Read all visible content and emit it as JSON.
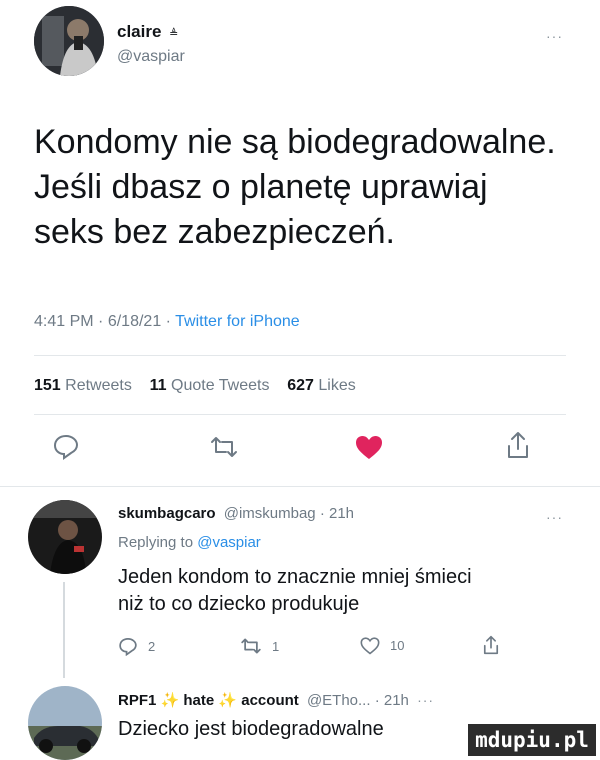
{
  "main_tweet": {
    "display_name": "claire",
    "badge": "≜",
    "handle": "@vaspiar",
    "more": "···",
    "text_line1": "Kondomy nie są biodegradowalne.",
    "text_line2": "Jeśli dbasz o planetę uprawiaj",
    "text_line3": "seks bez zabezpieczeń.",
    "time": "4:41 PM",
    "date": "6/18/21",
    "source": "Twitter for iPhone",
    "sep": "·",
    "stats": {
      "retweets_count": "151",
      "retweets_label": "Retweets",
      "quotes_count": "11",
      "quotes_label": "Quote Tweets",
      "likes_count": "627",
      "likes_label": "Likes"
    },
    "icons": [
      "reply-icon",
      "retweet-icon",
      "like-icon",
      "share-icon"
    ],
    "colors": {
      "like": "#e0245e",
      "link": "#2a8ee6",
      "muted": "#6e7a85"
    }
  },
  "reply1": {
    "name": "skumbagcaro",
    "handle": "@imskumbag",
    "time": "21h",
    "sep": "·",
    "more": "···",
    "replying_prefix": "Replying to",
    "replying_to": "@vaspiar",
    "text_line1": "Jeden kondom to znacznie mniej śmieci",
    "text_line2": "niż to co dziecko produkuje",
    "reply_count": "2",
    "retweet_count": "1",
    "like_count": "10"
  },
  "reply2": {
    "name": "RPF1",
    "name_emoji1": "✨",
    "name_mid": "hate",
    "name_emoji2": "✨",
    "name_end": "account",
    "handle": "@ETho...",
    "time": "21h",
    "sep": "·",
    "more": "···",
    "text_line1": "Dziecko jest biodegradowalne"
  },
  "watermark": "mdupiu.pl"
}
